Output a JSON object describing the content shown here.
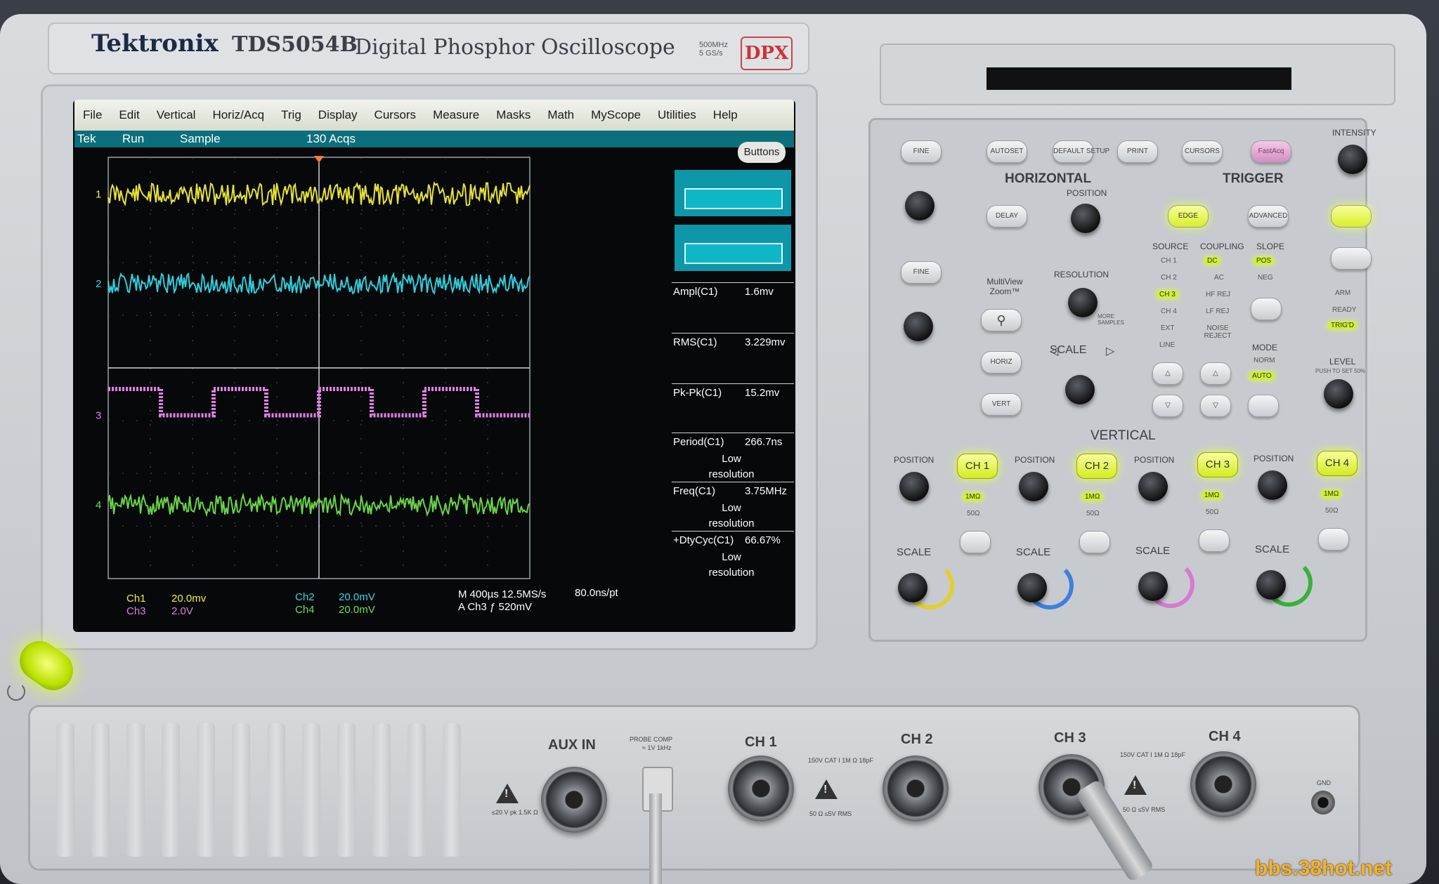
{
  "header": {
    "brand": "Tektronix",
    "model": "TDS5054B",
    "description": "Digital Phosphor Oscilloscope",
    "specs": "500MHz\n5 GS/s",
    "badge": "DPX"
  },
  "menu": [
    "File",
    "Edit",
    "Vertical",
    "Horiz/Acq",
    "Trig",
    "Display",
    "Cursors",
    "Measure",
    "Masks",
    "Math",
    "MyScope",
    "Utilities",
    "Help"
  ],
  "status": {
    "tek": "Tek",
    "run": "Run",
    "mode": "Sample",
    "acqs": "130 Acqs",
    "buttons": "Buttons"
  },
  "channel_markers": [
    "1",
    "2",
    "3",
    "4"
  ],
  "measurements": [
    {
      "label": "Ampl(C1)",
      "value": "1.6mv",
      "note": ""
    },
    {
      "label": "RMS(C1)",
      "value": "3.229mv",
      "note": ""
    },
    {
      "label": "Pk-Pk(C1)",
      "value": "15.2mv",
      "note": ""
    },
    {
      "label": "Period(C1)",
      "value": "266.7ns",
      "note": "Low resolution"
    },
    {
      "label": "Freq(C1)",
      "value": "3.75MHz",
      "note": "Low resolution"
    },
    {
      "label": "+DtyCyc(C1)",
      "value": "66.67%",
      "note": "Low resolution"
    }
  ],
  "readouts": {
    "ch1": "Ch1",
    "ch1_scale": "20.0mv",
    "ch3": "Ch3",
    "ch3_scale": "2.0V",
    "ch2": "Ch2",
    "ch2_scale": "20.0mV",
    "ch4": "Ch4",
    "ch4_scale": "20.0mV",
    "timebase": "M 400µs 12.5MS/s",
    "resolution": "80.0ns/pt",
    "trigger": "A  Ch3  ƒ  520mV"
  },
  "trace_colors": {
    "ch1": "#f2ee3a",
    "ch2": "#35d8e6",
    "ch3": "#e07fe0",
    "ch4": "#6fe04a"
  },
  "panel": {
    "fine": "FINE",
    "autoset": "AUTOSET",
    "default_setup": "DEFAULT SETUP",
    "print": "PRINT",
    "cursors": "CURSORS",
    "fastacq": "FastAcq",
    "intensity": "INTENSITY",
    "horizontal": "HORIZONTAL",
    "trigger": "TRIGGER",
    "position": "POSITION",
    "delay": "DELAY",
    "resolution": "RESOLUTION",
    "scale": "SCALE",
    "multiview": "MultiView Zoom™",
    "horiz": "HORIZ",
    "vert": "VERT",
    "more_samples": "MORE SAMPLES",
    "edge": "EDGE",
    "advanced": "ADVANCED",
    "source": "SOURCE",
    "coupling": "COUPLING",
    "slope": "SLOPE",
    "sources": [
      "CH 1",
      "CH 2",
      "CH 3",
      "CH 4",
      "EXT",
      "LINE"
    ],
    "couplings": [
      "DC",
      "AC",
      "HF REJ",
      "LF REJ",
      "NOISE REJECT"
    ],
    "slopes": [
      "POS",
      "NEG"
    ],
    "mode": "MODE",
    "norm": "NORM",
    "auto": "AUTO",
    "arm": "ARM",
    "ready": "READY",
    "trigd": "TRIG'D",
    "level": "LEVEL",
    "level_sub": "PUSH TO SET 50%",
    "vertical": "VERTICAL",
    "channels": [
      "CH 1",
      "CH 2",
      "CH 3",
      "CH 4"
    ],
    "imp_1m": "1MΩ",
    "imp_50": "50Ω"
  },
  "front": {
    "aux_in": "AUX IN",
    "probe_comp": "PROBE COMP",
    "probe_comp_sub": "≈ 1V\n1kHz",
    "aux_rating": "≤20 V pk\n1.5K Ω",
    "ch_rating": "150V CAT I\n1M Ω 18pF",
    "ch_50": "50 Ω\n≤5V RMS",
    "gnd": "GND",
    "inputs": [
      "CH 1",
      "CH 2",
      "CH 3",
      "CH 4"
    ]
  },
  "watermark": "bbs.38hot.net"
}
